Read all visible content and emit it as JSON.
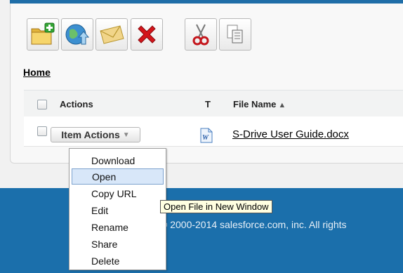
{
  "toolbar": {
    "buttons": [
      {
        "icon": "new-folder-icon"
      },
      {
        "icon": "upload-globe-icon"
      },
      {
        "icon": "email-envelope-icon"
      },
      {
        "icon": "delete-x-icon"
      },
      {
        "icon": "cut-scissors-icon"
      },
      {
        "icon": "copy-icon"
      }
    ]
  },
  "breadcrumb": {
    "home": "Home"
  },
  "table": {
    "headers": {
      "actions": "Actions",
      "type": "T",
      "file_name": "File Name"
    },
    "sort_indicator": "▲",
    "rows": [
      {
        "actions_button": "Item Actions",
        "type_icon": "word-document-icon",
        "file_name": "S-Drive User Guide.docx"
      }
    ]
  },
  "menu": {
    "items": [
      "Download",
      "Open",
      "Copy URL",
      "Edit",
      "Rename",
      "Share",
      "Delete"
    ],
    "active_index": 1
  },
  "tooltip": "Open File in New Window",
  "footer": {
    "copyright": "© 2000-2014 salesforce.com, inc. All rights"
  },
  "colors": {
    "footer_band": "#1b6fab",
    "menu_highlight": "#d8e7f9",
    "tooltip_bg": "#ffffe1"
  }
}
